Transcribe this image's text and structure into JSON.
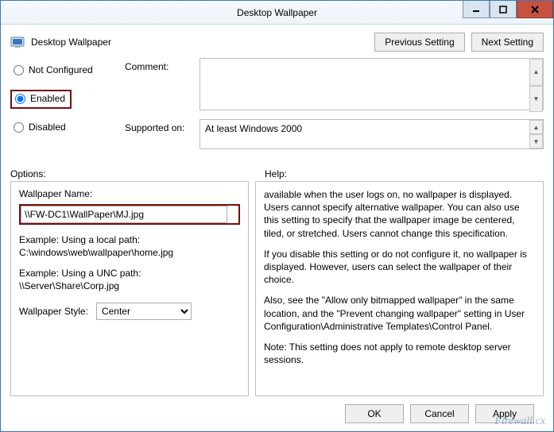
{
  "titlebar": {
    "title": "Desktop Wallpaper"
  },
  "header": {
    "title": "Desktop Wallpaper",
    "prev_btn": "Previous Setting",
    "next_btn": "Next Setting"
  },
  "state": {
    "not_configured_label": "Not Configured",
    "enabled_label": "Enabled",
    "disabled_label": "Disabled",
    "selected": "enabled"
  },
  "comment": {
    "label": "Comment:",
    "value": ""
  },
  "supported": {
    "label": "Supported on:",
    "value": "At least Windows 2000"
  },
  "labels": {
    "options": "Options:",
    "help": "Help:"
  },
  "options": {
    "wallpaper_name_label": "Wallpaper Name:",
    "wallpaper_name_value": "\\\\FW-DC1\\WallPaper\\MJ.jpg",
    "example_local_label": "Example: Using a local path:",
    "example_local_value": "C:\\windows\\web\\wallpaper\\home.jpg",
    "example_unc_label": "Example: Using a UNC path:",
    "example_unc_value": "\\\\Server\\Share\\Corp.jpg",
    "style_label": "Wallpaper Style:",
    "style_value": "Center"
  },
  "help": {
    "p1": "available when the user logs on, no wallpaper is displayed. Users cannot specify alternative wallpaper. You can also use this setting to specify that the wallpaper image be centered, tiled, or stretched. Users cannot change this specification.",
    "p2": "If you disable this setting or do not configure it, no wallpaper is displayed. However, users can select the wallpaper of their choice.",
    "p3": "Also, see the \"Allow only bitmapped wallpaper\" in the same location, and the \"Prevent changing wallpaper\" setting in User Configuration\\Administrative Templates\\Control Panel.",
    "p4": "Note: This setting does not apply to remote desktop server sessions."
  },
  "footer": {
    "ok": "OK",
    "cancel": "Cancel",
    "apply": "Apply"
  },
  "watermark": "Firewall.cx"
}
